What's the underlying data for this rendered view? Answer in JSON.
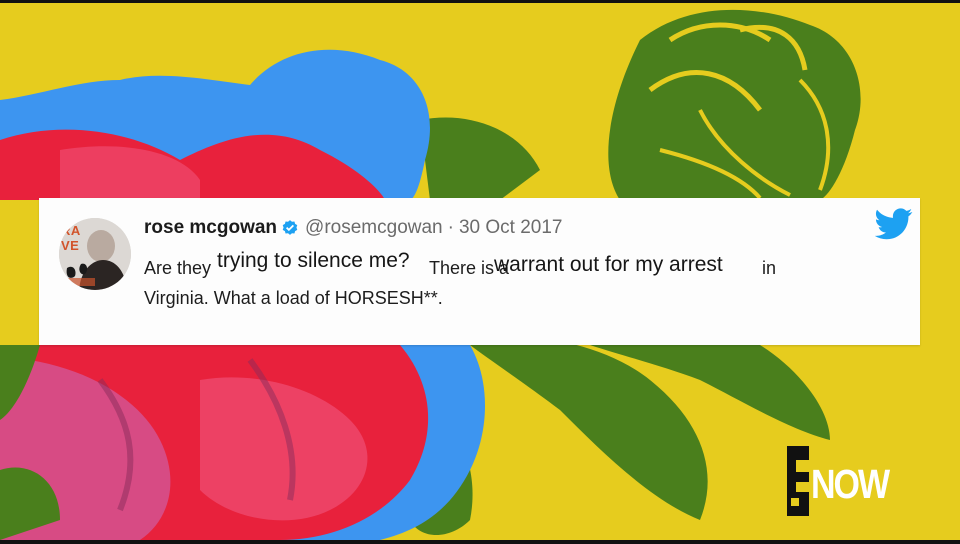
{
  "background": {
    "yellow": "#e6cc1e",
    "rose_colors": [
      "#e8213c",
      "#3d95f0",
      "#4a7f1c",
      "#c86fc0"
    ]
  },
  "tweet": {
    "display_name": "rose mcgowan",
    "verified_icon": "verified-badge-icon",
    "handle": "@rosemcgowan",
    "separator": "·",
    "date": "30 Oct 2017",
    "text_segments": {
      "s1": "Are they",
      "s2": "trying to silence me?",
      "s3": "There is a",
      "s4": "warrant out for my arrest",
      "s5": "in"
    },
    "line2": "Virginia.  What a load of HORSESH**.",
    "brand_icon": "twitter-bird-icon",
    "brand_color": "#1da1f2",
    "avatar_overlay": [
      "RA",
      "VE"
    ]
  },
  "logo": {
    "e_icon": "e-logo-icon",
    "text": "NOW"
  }
}
